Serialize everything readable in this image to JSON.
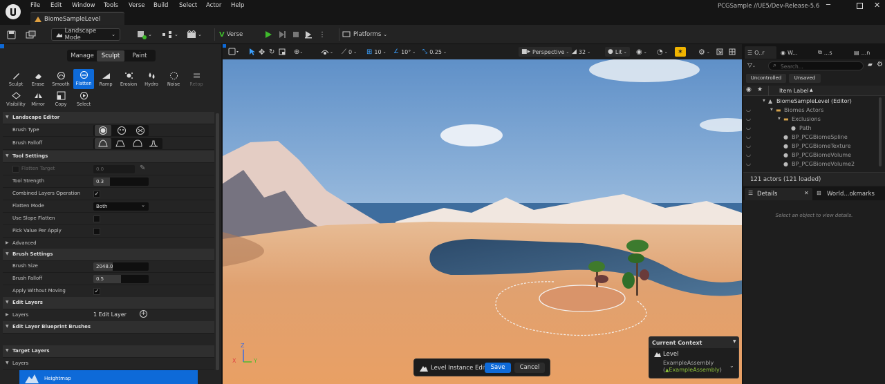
{
  "menu": [
    "File",
    "Edit",
    "Window",
    "Tools",
    "Verse",
    "Build",
    "Select",
    "Actor",
    "Help"
  ],
  "project_label": "PCGSample //UE5/Dev-Release-5.6",
  "document_tab": "BiomeSampleLevel",
  "toolbar": {
    "mode_label": "Landscape Mode",
    "verse_label": "Verse",
    "platforms_label": "Platforms"
  },
  "landscape": {
    "modes": [
      "Manage",
      "Sculpt",
      "Paint"
    ],
    "active_mode": "Sculpt",
    "tools_row1": [
      {
        "label": "Sculpt",
        "icon": "sculpt-icon"
      },
      {
        "label": "Erase",
        "icon": "erase-icon"
      },
      {
        "label": "Smooth",
        "icon": "smooth-icon"
      },
      {
        "label": "Flatten",
        "icon": "flatten-icon"
      },
      {
        "label": "Ramp",
        "icon": "ramp-icon"
      },
      {
        "label": "Erosion",
        "icon": "erosion-icon"
      },
      {
        "label": "Hydro",
        "icon": "hydro-icon"
      },
      {
        "label": "Noise",
        "icon": "noise-icon"
      },
      {
        "label": "Retop",
        "icon": "retop-icon"
      }
    ],
    "tools_row2": [
      {
        "label": "Visibility",
        "icon": "visibility-icon"
      },
      {
        "label": "Mirror",
        "icon": "mirror-icon"
      },
      {
        "label": "Copy",
        "icon": "copy-icon"
      },
      {
        "label": "Select",
        "icon": "select-icon"
      }
    ],
    "active_tool": "Flatten",
    "sections": {
      "landscape_editor": "Landscape Editor",
      "brush_type": "Brush Type",
      "brush_falloff_type": "Brush Falloff",
      "tool_settings": "Tool Settings",
      "flatten_target": "Flatten Target",
      "flatten_target_value": "0.0",
      "tool_strength": "Tool Strength",
      "tool_strength_value": "0.3",
      "combined_layers": "Combined Layers Operation",
      "flatten_mode": "Flatten Mode",
      "flatten_mode_value": "Both",
      "use_slope": "Use Slope Flatten",
      "pick_value": "Pick Value Per Apply",
      "advanced": "Advanced",
      "brush_settings": "Brush Settings",
      "brush_size": "Brush Size",
      "brush_size_value": "2048.0",
      "brush_falloff": "Brush Falloff",
      "brush_falloff_value": "0.5",
      "apply_without_moving": "Apply Without Moving",
      "edit_layers": "Edit Layers",
      "layers": "Layers",
      "layers_value": "1 Edit Layer",
      "edit_layer_bp": "Edit Layer Blueprint Brushes",
      "target_layers": "Target Layers",
      "target_layers_layers": "Layers",
      "heightmap": "Heightmap"
    }
  },
  "viewport": {
    "perspective": "Perspective",
    "fov": "32",
    "lit": "Lit",
    "snap_translate": "0",
    "snap_grid": "10",
    "snap_rotate": "10°",
    "snap_scale": "0.25",
    "axis_x": "X",
    "axis_y": "Y",
    "axis_z": "Z",
    "level_instance_edit": "Level Instance Edit",
    "save": "Save",
    "cancel": "Cancel",
    "context": {
      "title": "Current Context",
      "level": "Level",
      "assembly": "ExampleAssembly",
      "assembly_sub": "ExampleAssembly",
      "paren_open": "(",
      "paren_close": ")"
    }
  },
  "outliner": {
    "tabs": [
      "O..r",
      "W...",
      "...s",
      "...n"
    ],
    "search_placeholder": "Search...",
    "filters": [
      "Uncontrolled",
      "Unsaved"
    ],
    "column": "Item Label",
    "items": [
      {
        "label": "BiomeSampleLevel (Editor)",
        "indent": 0
      },
      {
        "label": "Biomes Actors",
        "indent": 1
      },
      {
        "label": "Exclusions",
        "indent": 2
      },
      {
        "label": "Path",
        "indent": 3
      },
      {
        "label": "BP_PCGBiomeSpline",
        "indent": 2
      },
      {
        "label": "BP_PCGBiomeTexture",
        "indent": 2
      },
      {
        "label": "BP_PCGBiomeVolume",
        "indent": 2
      },
      {
        "label": "BP_PCGBiomeVolume2",
        "indent": 2
      }
    ],
    "actor_count": "121 actors (121 loaded)"
  },
  "details": {
    "tab1": "Details",
    "tab2": "World...okmarks",
    "empty_text": "Select an object to view details."
  },
  "colors": {
    "accent_blue": "#0e6ad8",
    "play_green": "#3fba2c",
    "context_green": "#8fc23a"
  }
}
